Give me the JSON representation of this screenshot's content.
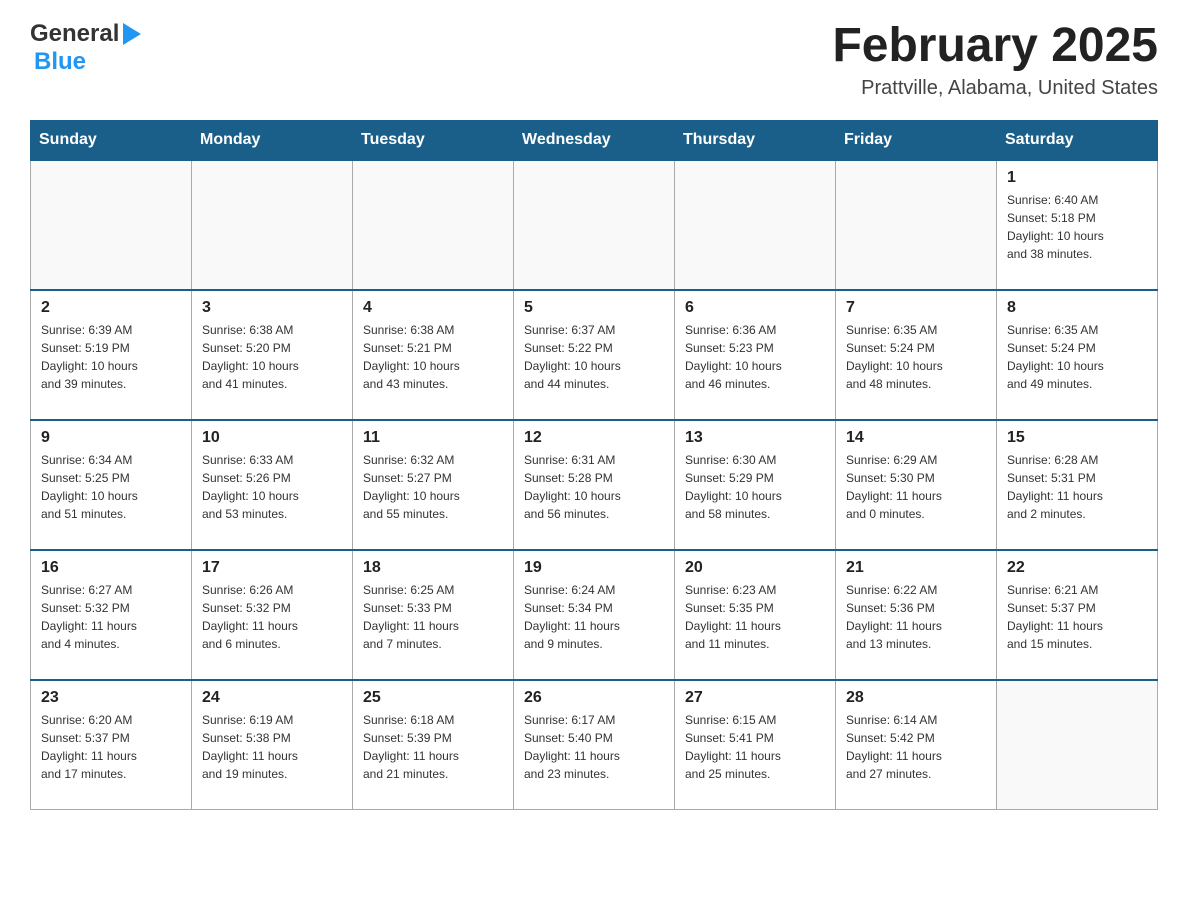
{
  "header": {
    "logo_general": "General",
    "logo_blue": "Blue",
    "title": "February 2025",
    "location": "Prattville, Alabama, United States"
  },
  "weekdays": [
    "Sunday",
    "Monday",
    "Tuesday",
    "Wednesday",
    "Thursday",
    "Friday",
    "Saturday"
  ],
  "weeks": [
    [
      {
        "day": "",
        "info": ""
      },
      {
        "day": "",
        "info": ""
      },
      {
        "day": "",
        "info": ""
      },
      {
        "day": "",
        "info": ""
      },
      {
        "day": "",
        "info": ""
      },
      {
        "day": "",
        "info": ""
      },
      {
        "day": "1",
        "info": "Sunrise: 6:40 AM\nSunset: 5:18 PM\nDaylight: 10 hours\nand 38 minutes."
      }
    ],
    [
      {
        "day": "2",
        "info": "Sunrise: 6:39 AM\nSunset: 5:19 PM\nDaylight: 10 hours\nand 39 minutes."
      },
      {
        "day": "3",
        "info": "Sunrise: 6:38 AM\nSunset: 5:20 PM\nDaylight: 10 hours\nand 41 minutes."
      },
      {
        "day": "4",
        "info": "Sunrise: 6:38 AM\nSunset: 5:21 PM\nDaylight: 10 hours\nand 43 minutes."
      },
      {
        "day": "5",
        "info": "Sunrise: 6:37 AM\nSunset: 5:22 PM\nDaylight: 10 hours\nand 44 minutes."
      },
      {
        "day": "6",
        "info": "Sunrise: 6:36 AM\nSunset: 5:23 PM\nDaylight: 10 hours\nand 46 minutes."
      },
      {
        "day": "7",
        "info": "Sunrise: 6:35 AM\nSunset: 5:24 PM\nDaylight: 10 hours\nand 48 minutes."
      },
      {
        "day": "8",
        "info": "Sunrise: 6:35 AM\nSunset: 5:24 PM\nDaylight: 10 hours\nand 49 minutes."
      }
    ],
    [
      {
        "day": "9",
        "info": "Sunrise: 6:34 AM\nSunset: 5:25 PM\nDaylight: 10 hours\nand 51 minutes."
      },
      {
        "day": "10",
        "info": "Sunrise: 6:33 AM\nSunset: 5:26 PM\nDaylight: 10 hours\nand 53 minutes."
      },
      {
        "day": "11",
        "info": "Sunrise: 6:32 AM\nSunset: 5:27 PM\nDaylight: 10 hours\nand 55 minutes."
      },
      {
        "day": "12",
        "info": "Sunrise: 6:31 AM\nSunset: 5:28 PM\nDaylight: 10 hours\nand 56 minutes."
      },
      {
        "day": "13",
        "info": "Sunrise: 6:30 AM\nSunset: 5:29 PM\nDaylight: 10 hours\nand 58 minutes."
      },
      {
        "day": "14",
        "info": "Sunrise: 6:29 AM\nSunset: 5:30 PM\nDaylight: 11 hours\nand 0 minutes."
      },
      {
        "day": "15",
        "info": "Sunrise: 6:28 AM\nSunset: 5:31 PM\nDaylight: 11 hours\nand 2 minutes."
      }
    ],
    [
      {
        "day": "16",
        "info": "Sunrise: 6:27 AM\nSunset: 5:32 PM\nDaylight: 11 hours\nand 4 minutes."
      },
      {
        "day": "17",
        "info": "Sunrise: 6:26 AM\nSunset: 5:32 PM\nDaylight: 11 hours\nand 6 minutes."
      },
      {
        "day": "18",
        "info": "Sunrise: 6:25 AM\nSunset: 5:33 PM\nDaylight: 11 hours\nand 7 minutes."
      },
      {
        "day": "19",
        "info": "Sunrise: 6:24 AM\nSunset: 5:34 PM\nDaylight: 11 hours\nand 9 minutes."
      },
      {
        "day": "20",
        "info": "Sunrise: 6:23 AM\nSunset: 5:35 PM\nDaylight: 11 hours\nand 11 minutes."
      },
      {
        "day": "21",
        "info": "Sunrise: 6:22 AM\nSunset: 5:36 PM\nDaylight: 11 hours\nand 13 minutes."
      },
      {
        "day": "22",
        "info": "Sunrise: 6:21 AM\nSunset: 5:37 PM\nDaylight: 11 hours\nand 15 minutes."
      }
    ],
    [
      {
        "day": "23",
        "info": "Sunrise: 6:20 AM\nSunset: 5:37 PM\nDaylight: 11 hours\nand 17 minutes."
      },
      {
        "day": "24",
        "info": "Sunrise: 6:19 AM\nSunset: 5:38 PM\nDaylight: 11 hours\nand 19 minutes."
      },
      {
        "day": "25",
        "info": "Sunrise: 6:18 AM\nSunset: 5:39 PM\nDaylight: 11 hours\nand 21 minutes."
      },
      {
        "day": "26",
        "info": "Sunrise: 6:17 AM\nSunset: 5:40 PM\nDaylight: 11 hours\nand 23 minutes."
      },
      {
        "day": "27",
        "info": "Sunrise: 6:15 AM\nSunset: 5:41 PM\nDaylight: 11 hours\nand 25 minutes."
      },
      {
        "day": "28",
        "info": "Sunrise: 6:14 AM\nSunset: 5:42 PM\nDaylight: 11 hours\nand 27 minutes."
      },
      {
        "day": "",
        "info": ""
      }
    ]
  ]
}
